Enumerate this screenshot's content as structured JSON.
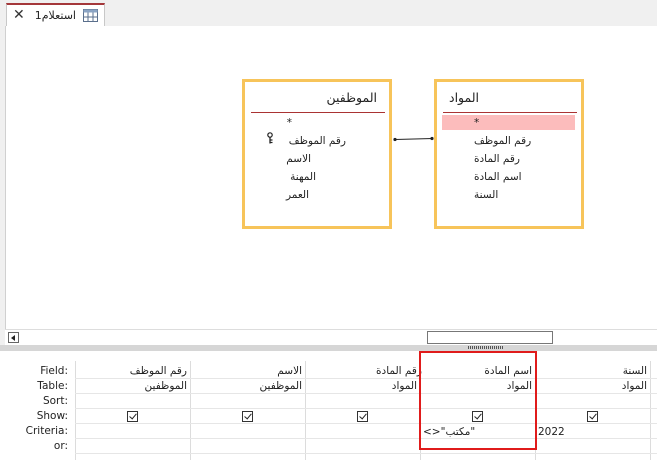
{
  "tab": {
    "label": "استعلام1",
    "icon": "query-icon",
    "close_icon": "close-icon"
  },
  "tables": {
    "employees": {
      "title": "الموظفين",
      "fields": [
        "*",
        "رقم الموظف",
        "الاسم",
        "المهنة",
        "العمر"
      ]
    },
    "subjects": {
      "title": "المواد",
      "fields": [
        "*",
        "رقم الموظف",
        "رقم المادة",
        "اسم المادة",
        "السنة"
      ],
      "selected_index": 0
    }
  },
  "grid": {
    "row_labels": [
      "Field:",
      "Table:",
      "Sort:",
      "Show:",
      "Criteria:",
      "or:"
    ],
    "columns": [
      {
        "field": "رقم الموظف",
        "table": "الموظفين",
        "show": true,
        "criteria": ""
      },
      {
        "field": "الاسم",
        "table": "الموظفين",
        "show": true,
        "criteria": ""
      },
      {
        "field": "رقم المادة",
        "table": "المواد",
        "show": true,
        "criteria": ""
      },
      {
        "field": "اسم المادة",
        "table": "المواد",
        "show": true,
        "criteria": "<>\"مكتب\""
      },
      {
        "field": "السنة",
        "table": "المواد",
        "show": true,
        "criteria": "2022"
      }
    ]
  },
  "colors": {
    "table_border": "#f7c45a",
    "selection": "#fcbcbc",
    "annotation": "#e01b1b",
    "tab_accent": "#a4373a"
  }
}
